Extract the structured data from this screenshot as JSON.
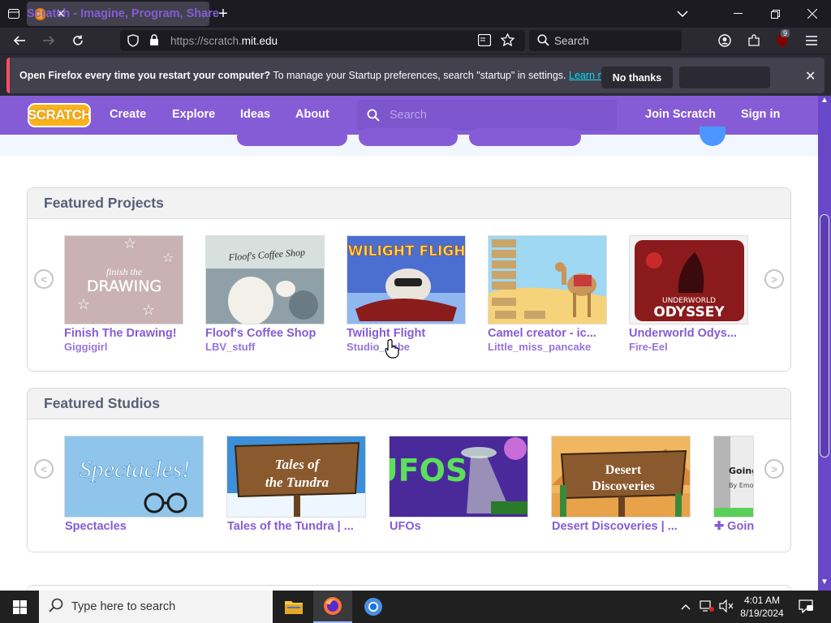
{
  "browser": {
    "tab_title": "Scratch - Imagine, Program, Share",
    "url_host_prefix": "https://scratch.",
    "url_host_main": "mit.edu",
    "search_placeholder": "Search",
    "extension_badge": "9"
  },
  "notification": {
    "bold_text": "Open Firefox every time you restart your computer?",
    "text": " To manage your Startup preferences, search \"startup\" in settings.",
    "link": "Learn more",
    "no_thanks": "No thanks"
  },
  "scratch": {
    "logo": "SCRATCH",
    "nav": [
      "Create",
      "Explore",
      "Ideas",
      "About"
    ],
    "search_placeholder": "Search",
    "join": "Join Scratch",
    "signin": "Sign in"
  },
  "featured_projects": {
    "heading": "Featured Projects",
    "items": [
      {
        "title": "Finish The Drawing!",
        "author": "Giggigirl",
        "thumb_text": "finish the DRAWING",
        "bg": "#c9b1b4"
      },
      {
        "title": "Floof's Coffee Shop",
        "author": "LBV_stuff",
        "thumb_text": "Floof's Coffee Shop",
        "bg": "#8fa0a8"
      },
      {
        "title": "Twilight Flight",
        "author": "Studio_Jnbe",
        "thumb_text": "TWILIGHT FLIGHT",
        "bg": "#4a6fd0"
      },
      {
        "title": "Camel creator - ic...",
        "author": "Little_miss_pancake",
        "thumb_text": "",
        "bg": "#f4d889"
      },
      {
        "title": "Underworld Odys...",
        "author": "Fire-Eel",
        "thumb_text": "UNDERWORLD ODYSSEY",
        "bg": "#7a1a1c"
      }
    ]
  },
  "featured_studios": {
    "heading": "Featured Studios",
    "items": [
      {
        "title": "Spectacles",
        "thumb_text": "Spectacles!",
        "bg": "#8fc5ea"
      },
      {
        "title": "Tales of the Tundra | ...",
        "thumb_text": "Tales of the Tundra",
        "bg": "#3d8fd9"
      },
      {
        "title": "UFOs",
        "thumb_text": "UFOS",
        "bg": "#4a2a9a"
      },
      {
        "title": "Desert Discoveries | ...",
        "thumb_text": "Desert Discoveries",
        "bg": "#f0b760"
      },
      {
        "title": "✚ Goin",
        "thumb_text": "Going",
        "bg": "#c8c8c8"
      }
    ]
  },
  "taskbar": {
    "search_placeholder": "Type here to search",
    "time": "4:01 AM",
    "date": "8/19/2024"
  },
  "colors": {
    "scratch_purple": "#855cd6",
    "firefox_dark": "#1c1b22",
    "firefox_toolbar": "#2b2a33"
  }
}
